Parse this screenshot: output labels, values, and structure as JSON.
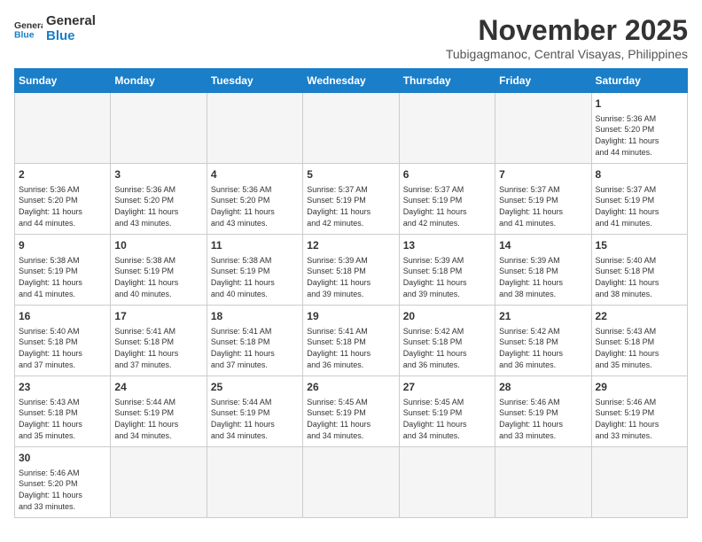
{
  "header": {
    "logo_general": "General",
    "logo_blue": "Blue",
    "month_title": "November 2025",
    "subtitle": "Tubigagmanoc, Central Visayas, Philippines"
  },
  "days_of_week": [
    "Sunday",
    "Monday",
    "Tuesday",
    "Wednesday",
    "Thursday",
    "Friday",
    "Saturday"
  ],
  "weeks": [
    [
      {
        "day": "",
        "info": ""
      },
      {
        "day": "",
        "info": ""
      },
      {
        "day": "",
        "info": ""
      },
      {
        "day": "",
        "info": ""
      },
      {
        "day": "",
        "info": ""
      },
      {
        "day": "",
        "info": ""
      },
      {
        "day": "1",
        "info": "Sunrise: 5:36 AM\nSunset: 5:20 PM\nDaylight: 11 hours\nand 44 minutes."
      }
    ],
    [
      {
        "day": "2",
        "info": "Sunrise: 5:36 AM\nSunset: 5:20 PM\nDaylight: 11 hours\nand 44 minutes."
      },
      {
        "day": "3",
        "info": "Sunrise: 5:36 AM\nSunset: 5:20 PM\nDaylight: 11 hours\nand 43 minutes."
      },
      {
        "day": "4",
        "info": "Sunrise: 5:36 AM\nSunset: 5:20 PM\nDaylight: 11 hours\nand 43 minutes."
      },
      {
        "day": "5",
        "info": "Sunrise: 5:37 AM\nSunset: 5:19 PM\nDaylight: 11 hours\nand 42 minutes."
      },
      {
        "day": "6",
        "info": "Sunrise: 5:37 AM\nSunset: 5:19 PM\nDaylight: 11 hours\nand 42 minutes."
      },
      {
        "day": "7",
        "info": "Sunrise: 5:37 AM\nSunset: 5:19 PM\nDaylight: 11 hours\nand 41 minutes."
      },
      {
        "day": "8",
        "info": "Sunrise: 5:37 AM\nSunset: 5:19 PM\nDaylight: 11 hours\nand 41 minutes."
      }
    ],
    [
      {
        "day": "9",
        "info": "Sunrise: 5:38 AM\nSunset: 5:19 PM\nDaylight: 11 hours\nand 41 minutes."
      },
      {
        "day": "10",
        "info": "Sunrise: 5:38 AM\nSunset: 5:19 PM\nDaylight: 11 hours\nand 40 minutes."
      },
      {
        "day": "11",
        "info": "Sunrise: 5:38 AM\nSunset: 5:19 PM\nDaylight: 11 hours\nand 40 minutes."
      },
      {
        "day": "12",
        "info": "Sunrise: 5:39 AM\nSunset: 5:18 PM\nDaylight: 11 hours\nand 39 minutes."
      },
      {
        "day": "13",
        "info": "Sunrise: 5:39 AM\nSunset: 5:18 PM\nDaylight: 11 hours\nand 39 minutes."
      },
      {
        "day": "14",
        "info": "Sunrise: 5:39 AM\nSunset: 5:18 PM\nDaylight: 11 hours\nand 38 minutes."
      },
      {
        "day": "15",
        "info": "Sunrise: 5:40 AM\nSunset: 5:18 PM\nDaylight: 11 hours\nand 38 minutes."
      }
    ],
    [
      {
        "day": "16",
        "info": "Sunrise: 5:40 AM\nSunset: 5:18 PM\nDaylight: 11 hours\nand 37 minutes."
      },
      {
        "day": "17",
        "info": "Sunrise: 5:41 AM\nSunset: 5:18 PM\nDaylight: 11 hours\nand 37 minutes."
      },
      {
        "day": "18",
        "info": "Sunrise: 5:41 AM\nSunset: 5:18 PM\nDaylight: 11 hours\nand 37 minutes."
      },
      {
        "day": "19",
        "info": "Sunrise: 5:41 AM\nSunset: 5:18 PM\nDaylight: 11 hours\nand 36 minutes."
      },
      {
        "day": "20",
        "info": "Sunrise: 5:42 AM\nSunset: 5:18 PM\nDaylight: 11 hours\nand 36 minutes."
      },
      {
        "day": "21",
        "info": "Sunrise: 5:42 AM\nSunset: 5:18 PM\nDaylight: 11 hours\nand 36 minutes."
      },
      {
        "day": "22",
        "info": "Sunrise: 5:43 AM\nSunset: 5:18 PM\nDaylight: 11 hours\nand 35 minutes."
      }
    ],
    [
      {
        "day": "23",
        "info": "Sunrise: 5:43 AM\nSunset: 5:18 PM\nDaylight: 11 hours\nand 35 minutes."
      },
      {
        "day": "24",
        "info": "Sunrise: 5:44 AM\nSunset: 5:19 PM\nDaylight: 11 hours\nand 34 minutes."
      },
      {
        "day": "25",
        "info": "Sunrise: 5:44 AM\nSunset: 5:19 PM\nDaylight: 11 hours\nand 34 minutes."
      },
      {
        "day": "26",
        "info": "Sunrise: 5:45 AM\nSunset: 5:19 PM\nDaylight: 11 hours\nand 34 minutes."
      },
      {
        "day": "27",
        "info": "Sunrise: 5:45 AM\nSunset: 5:19 PM\nDaylight: 11 hours\nand 34 minutes."
      },
      {
        "day": "28",
        "info": "Sunrise: 5:46 AM\nSunset: 5:19 PM\nDaylight: 11 hours\nand 33 minutes."
      },
      {
        "day": "29",
        "info": "Sunrise: 5:46 AM\nSunset: 5:19 PM\nDaylight: 11 hours\nand 33 minutes."
      }
    ],
    [
      {
        "day": "30",
        "info": "Sunrise: 5:46 AM\nSunset: 5:20 PM\nDaylight: 11 hours\nand 33 minutes."
      },
      {
        "day": "",
        "info": ""
      },
      {
        "day": "",
        "info": ""
      },
      {
        "day": "",
        "info": ""
      },
      {
        "day": "",
        "info": ""
      },
      {
        "day": "",
        "info": ""
      },
      {
        "day": "",
        "info": ""
      }
    ]
  ]
}
